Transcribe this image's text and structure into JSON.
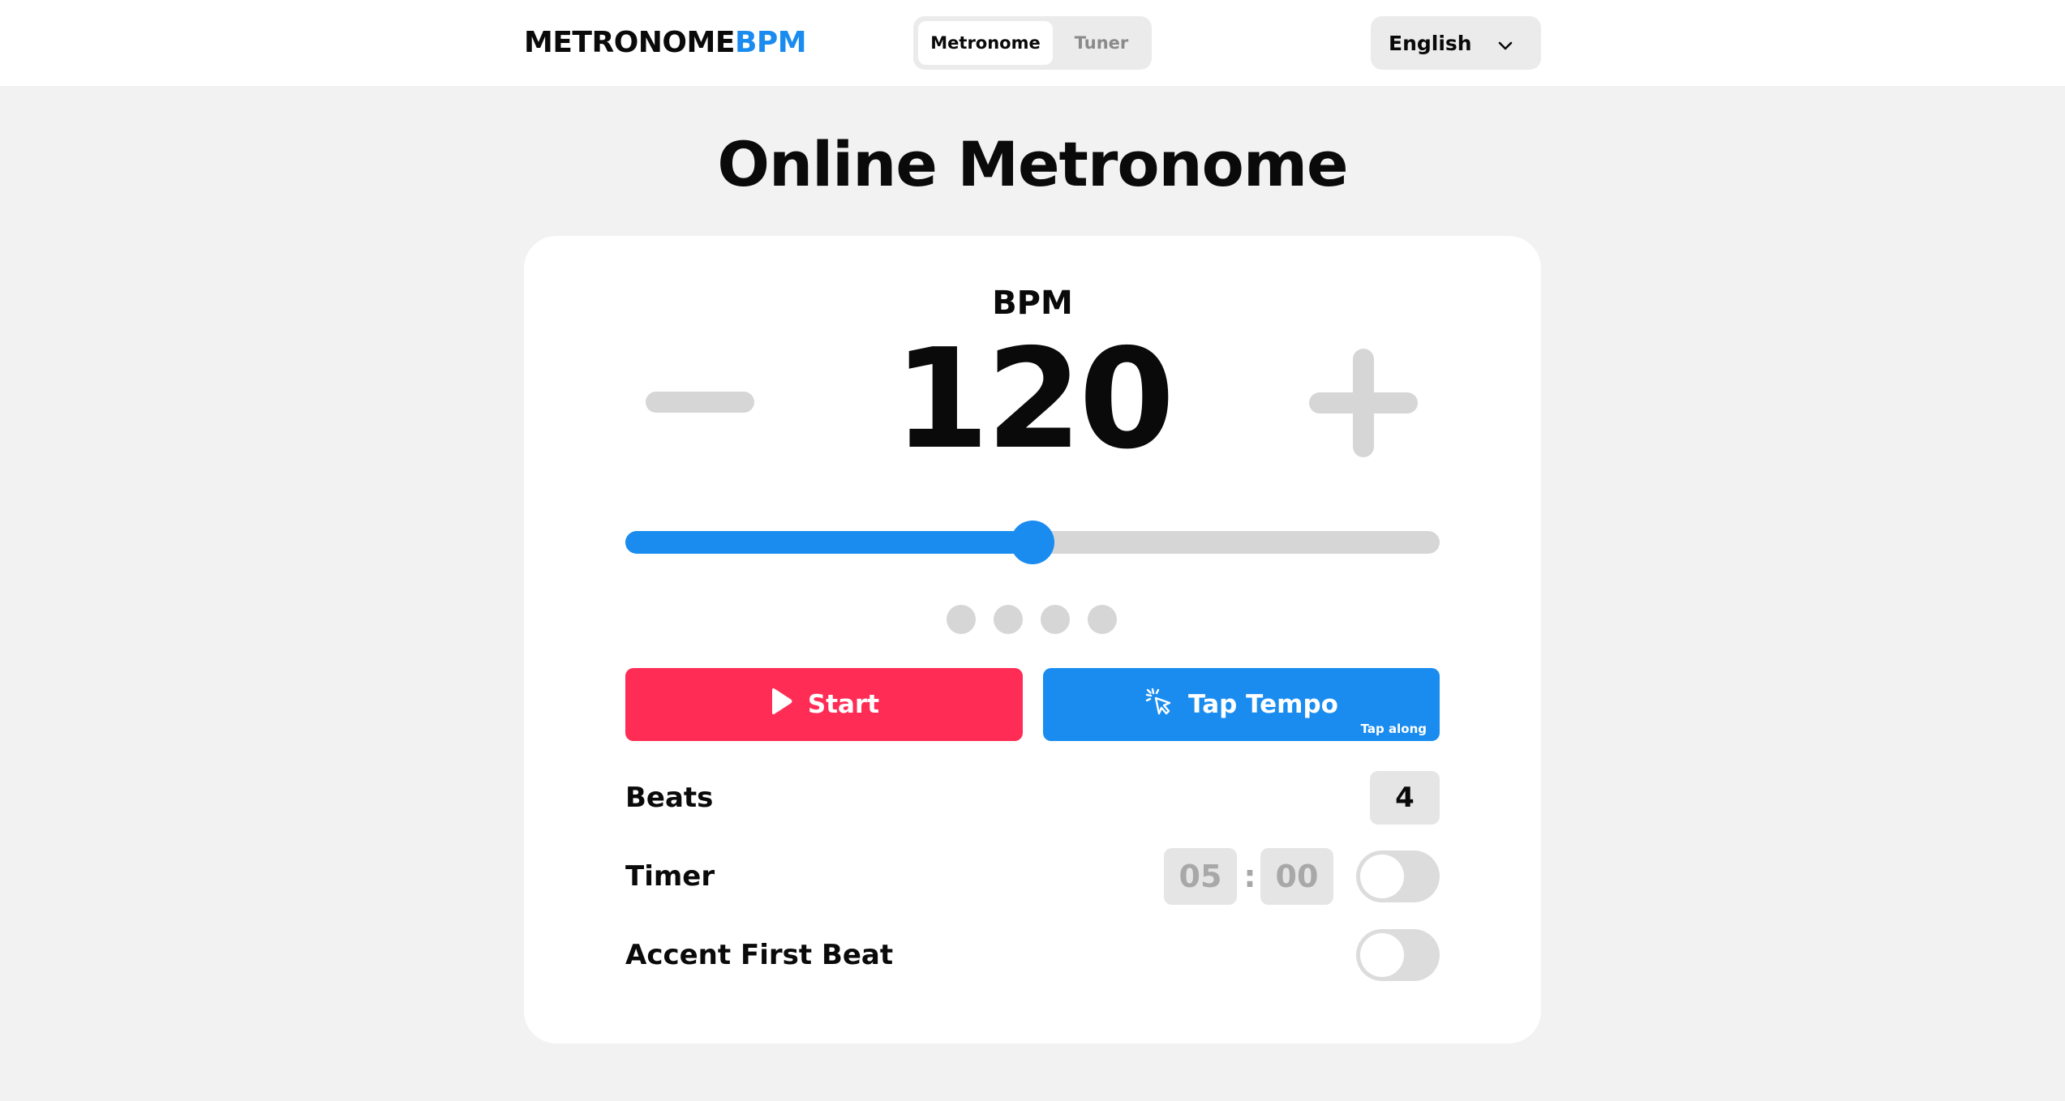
{
  "header": {
    "logo_part1": "METRONOME",
    "logo_part2": "BPM",
    "tabs": [
      {
        "label": "Metronome",
        "active": true
      },
      {
        "label": "Tuner",
        "active": false
      }
    ],
    "language": {
      "selected": "English",
      "icon": "chevron-down-icon"
    }
  },
  "page_title": "Online Metronome",
  "metronome": {
    "bpm_label": "BPM",
    "bpm_value": "120",
    "decrement_icon": "minus-icon",
    "increment_icon": "plus-icon",
    "slider_fraction": 0.5,
    "beat_count": 4,
    "start_button": {
      "label": "Start",
      "icon": "play-icon",
      "color": "#ff2d55"
    },
    "tap_button": {
      "label": "Tap Tempo",
      "sublabel": "Tap along",
      "icon": "tap-cursor-icon",
      "color": "#1a8cf0"
    },
    "beats": {
      "label": "Beats",
      "value": "4"
    },
    "timer": {
      "label": "Timer",
      "minutes": "05",
      "separator": ":",
      "seconds": "00",
      "enabled": false
    },
    "accent": {
      "label": "Accent First Beat",
      "enabled": false
    }
  },
  "colors": {
    "accent": "#1a8cf0",
    "start": "#ff2d55",
    "inactive": "#d6d6d6",
    "background": "#f2f2f2"
  }
}
